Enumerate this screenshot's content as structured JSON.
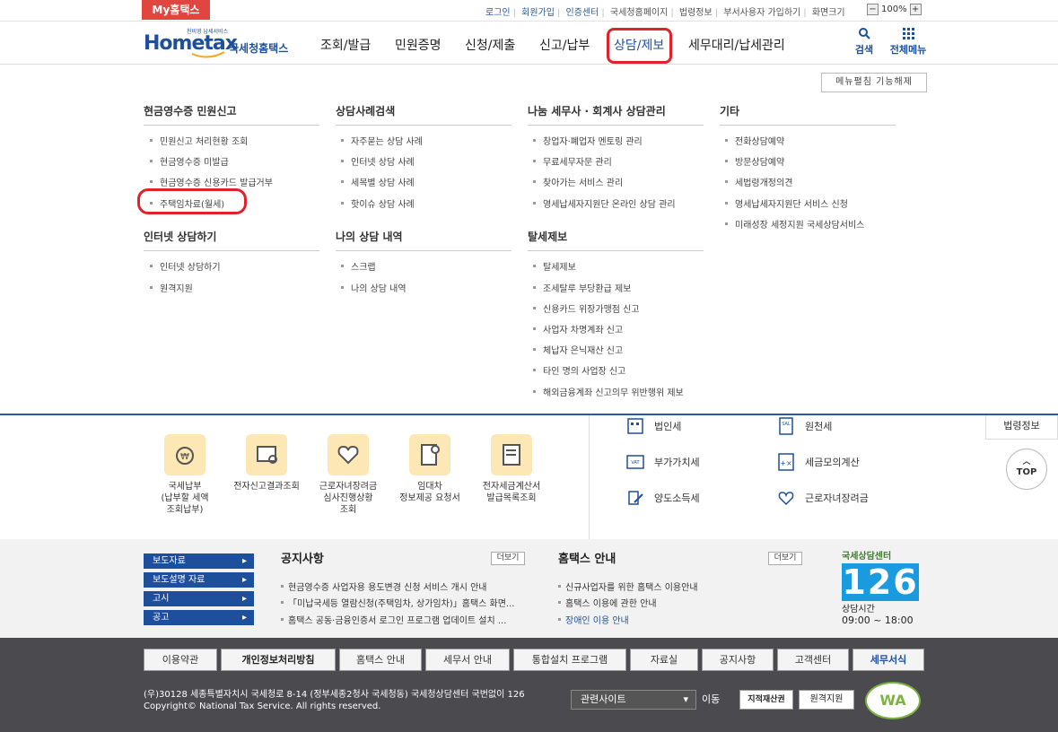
{
  "topbar": {
    "my_hometax": "My홈택스",
    "links": [
      "로그인",
      "회원가입",
      "인증센터",
      "국세청홈페이지",
      "법령정보",
      "부서사용자 가입하기",
      "화면크기"
    ],
    "zoom_minus": "−",
    "zoom_level": "100%",
    "zoom_plus": "+"
  },
  "logo": {
    "brand": "Hometax",
    "name": "국세청홈택스",
    "tagline": "친비영 납세서비스"
  },
  "gnb": [
    "조회/발급",
    "민원증명",
    "신청/제출",
    "신고/납부",
    "상담/제보",
    "세무대리/납세관리"
  ],
  "gnb_highlight": "상담/제보",
  "header_icons": {
    "search": "검색",
    "all_menu": "전체메뉴"
  },
  "menu_close": "메뉴펼침 기능해제",
  "megamenu": {
    "col1": {
      "heading": "현금영수증 민원신고",
      "items": [
        "민원신고 처리현황 조회",
        "현금영수증 미발급",
        "현금영수증 신용카드 발급거부",
        "주택임차료(월세)"
      ],
      "heading2": "인터넷 상담하기",
      "items2": [
        "인터넷 상담하기",
        "원격지원"
      ]
    },
    "col2": {
      "heading": "상담사례검색",
      "items": [
        "자주묻는 상담 사례",
        "인터넷 상담 사례",
        "세목별 상담 사례",
        "핫이슈 상담 사례"
      ],
      "heading2": "나의 상담 내역",
      "items2": [
        "스크랩",
        "나의 상담 내역"
      ]
    },
    "col3": {
      "heading": "나눔 세무사 · 회계사 상담관리",
      "items": [
        "창업자·폐업자 멘토링 관리",
        "무료세무자문 관리",
        "찾아가는 서비스 관리",
        "영세납세자지원단 온라인 상담 관리"
      ],
      "heading2": "탈세제보",
      "items2": [
        "탈세제보",
        "조세탈루 부당환급 제보",
        "신용카드 위장가맹점 신고",
        "사업자 차명계좌 신고",
        "체납자 은닉재산 신고",
        "타인 명의 사업장 신고",
        "해외금융계좌 신고의무 위반행위 제보"
      ]
    },
    "col4": {
      "heading": "기타",
      "items": [
        "전화상담예약",
        "방문상담예약",
        "세법령개정의견",
        "영세납세자지원단 서비스 신청",
        "미래성장 세정지원 국세상담서비스"
      ]
    }
  },
  "quick": [
    {
      "label": "국세납부\n(납부할 세액\n조회납부)",
      "icon": "tax-payment-icon"
    },
    {
      "label": "전자신고결과조회",
      "icon": "e-filing-result-icon"
    },
    {
      "label": "근로자녀장려금\n심사진행상황\n조회",
      "icon": "earned-income-credit-icon"
    },
    {
      "label": "임대차\n정보제공 요청서",
      "icon": "lease-info-request-icon"
    },
    {
      "label": "전자세금계산서\n발급목록조회",
      "icon": "e-tax-invoice-icon"
    }
  ],
  "taxlinks": [
    "법인세",
    "원천세",
    "부가가치세",
    "세금모의계산",
    "양도소득세",
    "근로자녀장려금"
  ],
  "law_info": "법령정보",
  "top_button": "TOP",
  "press": [
    "보도자료",
    "보도설명 자료",
    "고시",
    "공고"
  ],
  "notice": {
    "title": "공지사항",
    "more": "더보기",
    "items": [
      "현금영수증 사업자용 용도변경 신청 서비스 개시 안내",
      "「미납국세등 열람신청(주택임차, 상가임차)」홈택스 화면...",
      "홈택스 공동·금융인증서 로그인 프로그램 업데이트 설치 ..."
    ]
  },
  "guide": {
    "title": "홈택스 안내",
    "more": "더보기",
    "items": [
      "신규사업자를 위한 홈택스 이용안내",
      "홈택스 이용에 관한 안내",
      "장애인 이용 안내"
    ]
  },
  "center": {
    "label": "국세상담센터",
    "number": "126",
    "hours_label": "상담시간",
    "hours": "09:00 ~ 18:00"
  },
  "footer": {
    "links": [
      "이용약관",
      "개인정보처리방침",
      "홈택스 안내",
      "세무서 안내",
      "통합설치 프로그램",
      "자료실",
      "공지사항",
      "고객센터",
      "세무서식"
    ],
    "address": "(우)30128 세종특별자치시 국세청로 8-14 (정부세종2청사 국세청동) 국세청상담센터 국번없이 126",
    "copyright": "Copyright© National Tax Service. All rights reserved.",
    "related": "관련사이트",
    "go": "이동",
    "yellow_umbrella": "지적재산권",
    "remote": "원격지원",
    "wa": "WA"
  },
  "colors": {
    "accent": "#1e4f9c",
    "highlight": "#e0232a",
    "brand_red": "#e0463f"
  }
}
